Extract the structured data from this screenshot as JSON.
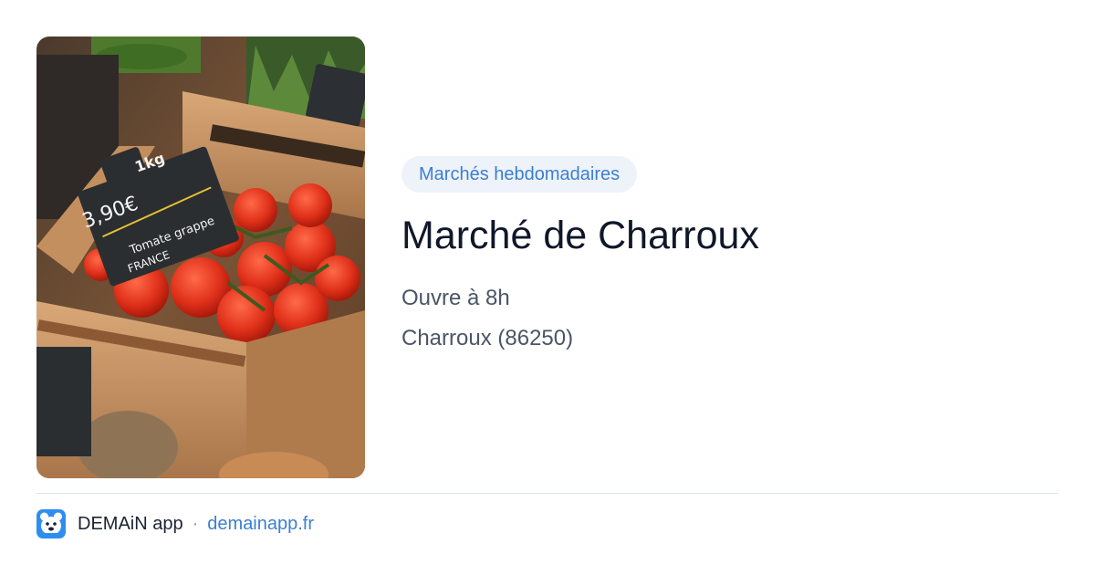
{
  "market": {
    "category": "Marchés hebdomadaires",
    "name": "Marché de Charroux",
    "hours": "Ouvre à 8h",
    "location": "Charroux (86250)"
  },
  "photo": {
    "alt": "tomato-crates-photo",
    "sign": {
      "weight": "1kg",
      "price": "3,90€",
      "product": "Tomate grappe",
      "origin": "FRANCE"
    }
  },
  "footer": {
    "app_name": "DEMAiN app",
    "separator": "·",
    "site": "demainapp.fr"
  },
  "colors": {
    "accent": "#3b7fd0",
    "badge_bg": "#eef3fa",
    "title": "#0f1729",
    "muted": "#4a5566"
  },
  "icons": {
    "app": "bear-app-icon"
  }
}
